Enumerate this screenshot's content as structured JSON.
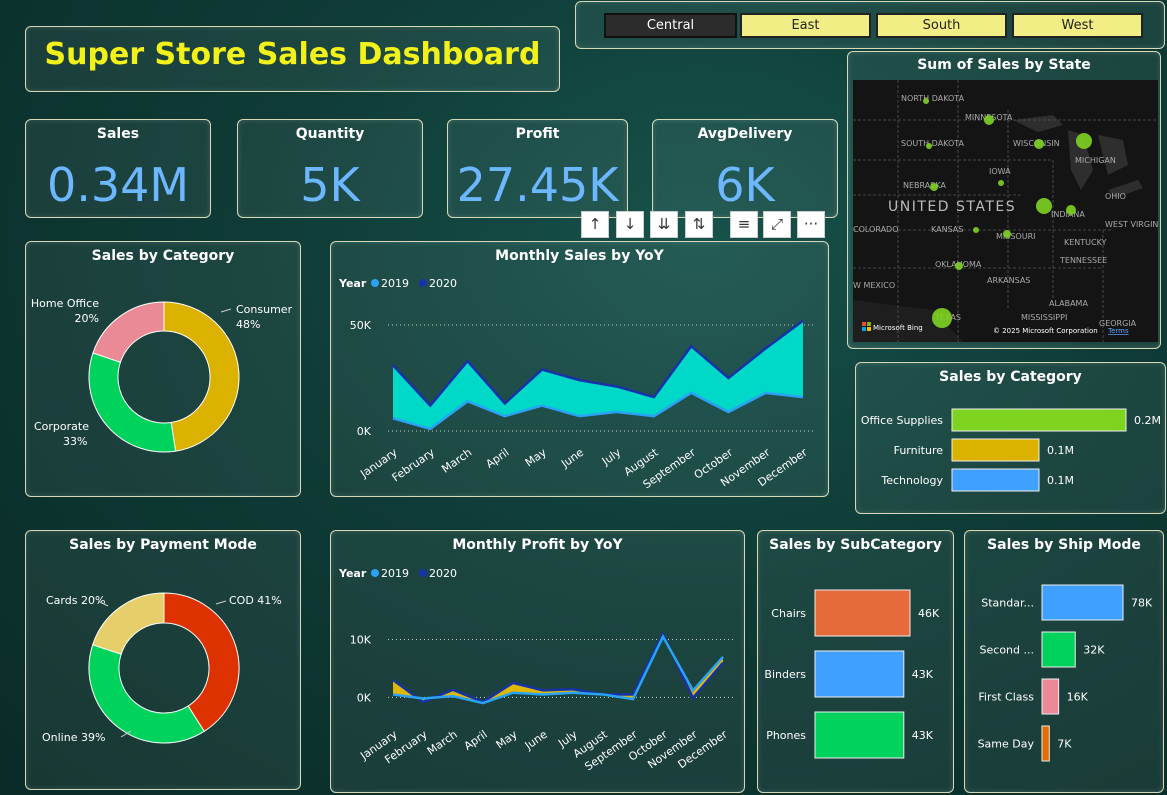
{
  "title": "Super Store Sales Dashboard",
  "slicer": {
    "options": [
      "Central",
      "East",
      "South",
      "West"
    ],
    "selected": "Central"
  },
  "kpis": [
    {
      "label": "Sales",
      "value": "0.34M"
    },
    {
      "label": "Quantity",
      "value": "5K"
    },
    {
      "label": "Profit",
      "value": "27.45K"
    },
    {
      "label": "AvgDelivery",
      "value": "6K"
    }
  ],
  "visual_toolbar": {
    "icons": [
      "arrow-up-icon",
      "arrow-down-icon",
      "double-arrow-down-icon",
      "expand-hierarchy-icon",
      "filter-icon",
      "focus-mode-icon",
      "more-options-icon"
    ],
    "labels": [
      "↑",
      "↓",
      "⇊",
      "⇅",
      "≡",
      "⤢",
      "···"
    ]
  },
  "category_donut": {
    "title": "Sales by Category",
    "colors": {
      "Consumer": "#dcb200",
      "Corporate": "#00d35c",
      "Home Office": "#e98a96"
    },
    "chart_data": {
      "type": "pie",
      "categories": [
        "Consumer",
        "Corporate",
        "Home Office"
      ],
      "values": [
        48,
        33,
        20
      ]
    },
    "labels": [
      {
        "name": "Consumer",
        "pct": "48%"
      },
      {
        "name": "Corporate",
        "pct": "33%"
      },
      {
        "name": "Home Office",
        "pct": "20%"
      }
    ]
  },
  "monthly_sales": {
    "title": "Monthly Sales by YoY",
    "legend_label": "Year",
    "colors": {
      "2019": "#2aa3f4",
      "2020": "#1632a8",
      "area": "#00d8c8"
    },
    "y_ticks": [
      "50K",
      "0K"
    ],
    "chart_data": {
      "type": "area",
      "categories": [
        "January",
        "February",
        "March",
        "April",
        "May",
        "June",
        "July",
        "August",
        "September",
        "October",
        "November",
        "December"
      ],
      "ylim": [
        0,
        50000
      ],
      "series": [
        {
          "name": "2019",
          "values": [
            6000,
            1000,
            14000,
            7000,
            12000,
            7000,
            9000,
            7000,
            18000,
            9000,
            18000,
            16000
          ]
        },
        {
          "name": "2020",
          "values": [
            31000,
            12000,
            33000,
            13000,
            29000,
            24000,
            21000,
            16000,
            40000,
            25000,
            39000,
            52000
          ]
        }
      ]
    }
  },
  "monthly_profit": {
    "title": "Monthly Profit by YoY",
    "legend_label": "Year",
    "colors": {
      "2019": "#2aa3f4",
      "2020": "#1632a8",
      "area": "#e0b800"
    },
    "y_ticks": [
      "10K",
      "0K"
    ],
    "chart_data": {
      "type": "area",
      "categories": [
        "January",
        "February",
        "March",
        "April",
        "May",
        "June",
        "July",
        "August",
        "September",
        "October",
        "November",
        "December"
      ],
      "ylim": [
        -1500,
        12000
      ],
      "series": [
        {
          "name": "2019",
          "values": [
            500,
            -200,
            200,
            -1000,
            800,
            500,
            800,
            500,
            -300,
            10500,
            1200,
            7000
          ]
        },
        {
          "name": "2020",
          "values": [
            3000,
            -800,
            1300,
            -800,
            2500,
            1200,
            1400,
            500,
            500,
            11000,
            -100,
            6000
          ]
        }
      ]
    }
  },
  "payment_donut": {
    "title": "Sales by Payment Mode",
    "colors": {
      "COD": "#dd3200",
      "Online": "#00d35c",
      "Cards": "#e6cf6a"
    },
    "chart_data": {
      "type": "pie",
      "categories": [
        "COD",
        "Online",
        "Cards"
      ],
      "values": [
        41,
        39,
        20
      ]
    },
    "labels": [
      "COD 41%",
      "Online 39%",
      "Cards 20%"
    ]
  },
  "map": {
    "title": "Sum of Sales by State",
    "place_labels": [
      "NORTH DAKOTA",
      "MINNESOTA",
      "SOUTH DAKOTA",
      "WISCONSIN",
      "MICHIGAN",
      "IOWA",
      "NEBRASKA",
      "OHIO",
      "UNITED STATES",
      "INDIANA",
      "KANSAS",
      "MISSOURI",
      "WEST VIRGINIA",
      "COLORADO",
      "KENTUCKY",
      "OKLAHOMA",
      "TENNESSEE",
      "ARKANSAS",
      "W MEXICO",
      "ALABAMA",
      "TEXAS",
      "MISSISSIPPI",
      "GEORGIA"
    ],
    "attribution": "Microsoft Bing",
    "copyright": "© 2025 Microsoft Corporation",
    "terms": "Terms"
  },
  "category_bars": {
    "title": "Sales by Category",
    "chart_data": {
      "type": "bar",
      "categories": [
        "Office Supplies",
        "Furniture",
        "Technology"
      ],
      "values": [
        0.2,
        0.1,
        0.1
      ]
    },
    "value_labels": [
      "0.2M",
      "0.1M",
      "0.1M"
    ],
    "colors": [
      "#7ed321",
      "#dcb200",
      "#3fa0ff"
    ]
  },
  "subcategory": {
    "title": "Sales by SubCategory",
    "chart_data": {
      "type": "bar",
      "categories": [
        "Chairs",
        "Binders",
        "Phones"
      ],
      "values": [
        46,
        43,
        43
      ]
    },
    "value_labels": [
      "46K",
      "43K",
      "43K"
    ],
    "colors": [
      "#e66b3a",
      "#3fa0ff",
      "#00d35c"
    ]
  },
  "shipmode": {
    "title": "Sales by Ship Mode",
    "chart_data": {
      "type": "bar",
      "categories": [
        "Standar...",
        "Second ...",
        "First Class",
        "Same Day"
      ],
      "values": [
        78,
        32,
        16,
        7
      ]
    },
    "value_labels": [
      "78K",
      "32K",
      "16K",
      "7K"
    ],
    "colors": [
      "#3fa0ff",
      "#00d35c",
      "#e98a96",
      "#e66b00"
    ]
  }
}
